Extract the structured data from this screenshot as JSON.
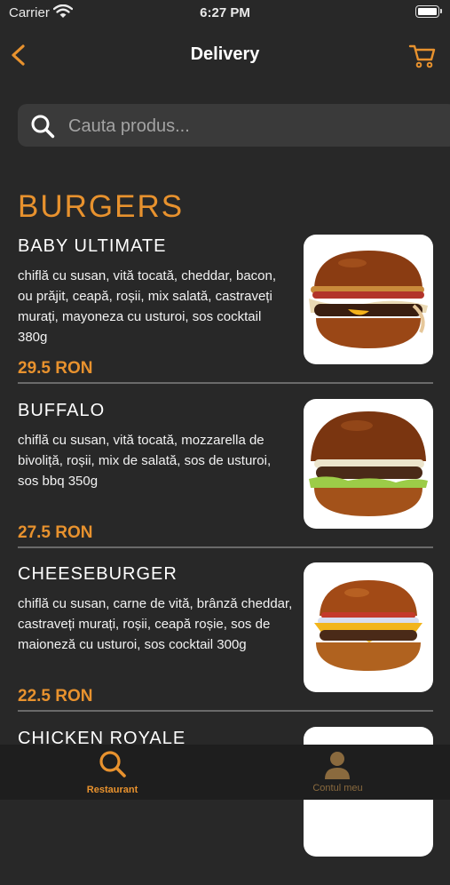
{
  "status_bar": {
    "carrier": "Carrier",
    "time": "6:27 PM"
  },
  "nav": {
    "title": "Delivery"
  },
  "search": {
    "placeholder": "Cauta produs..."
  },
  "category": {
    "title": "BURGERS"
  },
  "products": [
    {
      "name": "BABY ULTIMATE",
      "description": "chiflă cu susan, vită tocată, cheddar, bacon, ou prăjit, ceapă, roșii, mix salată, castraveți murați, mayoneza cu usturoi, sos cocktail 380g",
      "price": "29.5 RON"
    },
    {
      "name": "BUFFALO",
      "description": "chiflă cu susan, vită tocată, mozzarella de bivoliță, roșii, mix de salată, sos de usturoi, sos bbq 350g",
      "price": "27.5 RON"
    },
    {
      "name": "CHEESEBURGER",
      "description": "chiflă cu susan, carne de vită, brânză cheddar, castraveți murați, roșii, ceapă roșie, sos de maioneză cu usturoi, sos cocktail 300g",
      "price": "22.5 RON"
    },
    {
      "name": "CHICKEN ROYALE",
      "description": "",
      "price": ""
    }
  ],
  "tabs": [
    {
      "label": "Restaurant",
      "icon": "search-icon",
      "active": true
    },
    {
      "label": "Contul meu",
      "icon": "user-icon",
      "active": false
    }
  ],
  "colors": {
    "accent": "#e8922e",
    "background": "#282828",
    "tab_bar": "#1e1e1e",
    "search_bg": "#3a3a3a"
  }
}
